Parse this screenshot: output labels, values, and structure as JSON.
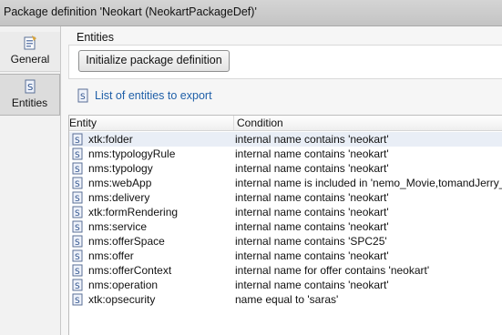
{
  "window": {
    "title": "Package definition 'Neokart (NeokartPackageDef)'"
  },
  "sidebar": {
    "tabs": [
      {
        "label": "General",
        "icon": "general-settings-icon"
      },
      {
        "label": "Entities",
        "icon": "entities-icon"
      }
    ]
  },
  "entities_section": {
    "group_label": "Entities",
    "init_button_label": "Initialize package definition",
    "list_link_label": "List of entities to export"
  },
  "table": {
    "columns": [
      "Entity",
      "Condition"
    ],
    "rows": [
      {
        "entity": "xtk:folder",
        "condition": "internal name contains 'neokart'"
      },
      {
        "entity": "nms:typologyRule",
        "condition": "internal name contains 'neokart'"
      },
      {
        "entity": "nms:typology",
        "condition": "internal name contains 'neokart'"
      },
      {
        "entity": "nms:webApp",
        "condition": "internal name is included in 'nemo_Movie,tomandJerry_"
      },
      {
        "entity": "nms:delivery",
        "condition": "internal name contains 'neokart'"
      },
      {
        "entity": "xtk:formRendering",
        "condition": "internal name contains 'neokart'"
      },
      {
        "entity": "nms:service",
        "condition": "internal name contains 'neokart'"
      },
      {
        "entity": "nms:offerSpace",
        "condition": "internal name contains 'SPC25'"
      },
      {
        "entity": "nms:offer",
        "condition": "internal name contains 'neokart'"
      },
      {
        "entity": "nms:offerContext",
        "condition": "internal name for offer contains 'neokart'"
      },
      {
        "entity": "nms:operation",
        "condition": "internal name contains 'neokart'"
      },
      {
        "entity": "xtk:opsecurity",
        "condition": "name equal to 'saras'"
      }
    ]
  },
  "colors": {
    "link": "#1f5fa8",
    "selected_row": "#e9eef6",
    "titlebar": "#cccccc"
  }
}
